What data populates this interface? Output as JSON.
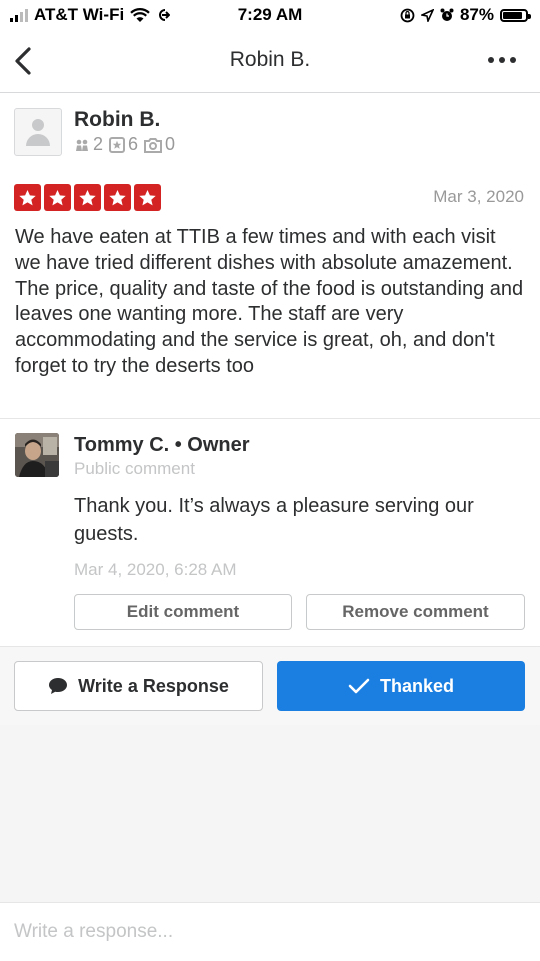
{
  "status_bar": {
    "carrier": "AT&T Wi-Fi",
    "time": "7:29 AM",
    "battery": "87%",
    "battery_level": 0.87
  },
  "nav": {
    "title": "Robin B."
  },
  "reviewer": {
    "name": "Robin B.",
    "friends": "2",
    "reviews": "6",
    "photos": "0"
  },
  "review": {
    "rating": 5,
    "date": "Mar 3, 2020",
    "text": "We have eaten at TTIB a few times and with each visit we have tried different dishes with absolute amazement. The price, quality and taste of the food is outstanding and leaves one wanting more. The staff are very accommodating and the service is great, oh, and don't forget to try the deserts too"
  },
  "owner_comment": {
    "name": "Tommy C. • Owner",
    "visibility": "Public comment",
    "text": "Thank you. It’s always a pleasure serving our guests.",
    "date": "Mar 4, 2020, 6:28 AM",
    "edit_label": "Edit comment",
    "remove_label": "Remove comment"
  },
  "actions": {
    "write_label": "Write a Response",
    "thanked_label": "Thanked"
  },
  "response_input": {
    "placeholder": "Write a response..."
  },
  "colors": {
    "star_red": "#d32323",
    "thanked_blue": "#1a7fe0"
  }
}
